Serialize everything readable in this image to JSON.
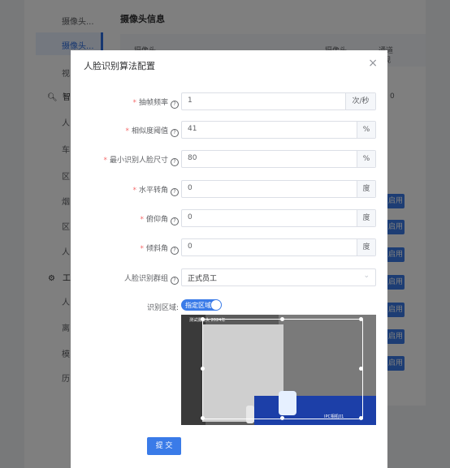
{
  "background": {
    "sidebar": {
      "items": [
        "摄像头...",
        "摄像头...",
        "视"
      ],
      "section_smart": "智",
      "smart_items": [
        "人",
        "车",
        "区",
        "烟",
        "区",
        "人"
      ],
      "section_tools": "工",
      "tool_items": [
        "人",
        "离",
        "模",
        "历"
      ]
    },
    "page_title": "摄像头信息",
    "table_headers": [
      "摄像头",
      "摄像头",
      "通道",
      "视"
    ],
    "row_value": "0",
    "row_button": "启用"
  },
  "dialog": {
    "title": "人脸识别算法配置",
    "close": "×",
    "fields": {
      "frame_rate": {
        "label": "抽帧频率",
        "value": "1",
        "unit": "次/秒"
      },
      "similarity": {
        "label": "相似度阈值",
        "value": "41",
        "unit": "%"
      },
      "min_face": {
        "label": "最小识别人脸尺寸",
        "value": "80",
        "unit": "%"
      },
      "horizontal": {
        "label": "水平转角",
        "value": "0",
        "unit": "度"
      },
      "pitch": {
        "label": "俯仰角",
        "value": "0",
        "unit": "度"
      },
      "tilt": {
        "label": "倾斜角",
        "value": "0",
        "unit": "度"
      },
      "group": {
        "label": "人脸识别群组",
        "value": "正式员工"
      },
      "region": {
        "label": "识别区域",
        "switch_text": "指定区域",
        "switch_on": true
      }
    },
    "preview_caption": "测试摄像头 2024年",
    "preview_caption2": "IPC相机01",
    "submit_label": "提 交"
  }
}
